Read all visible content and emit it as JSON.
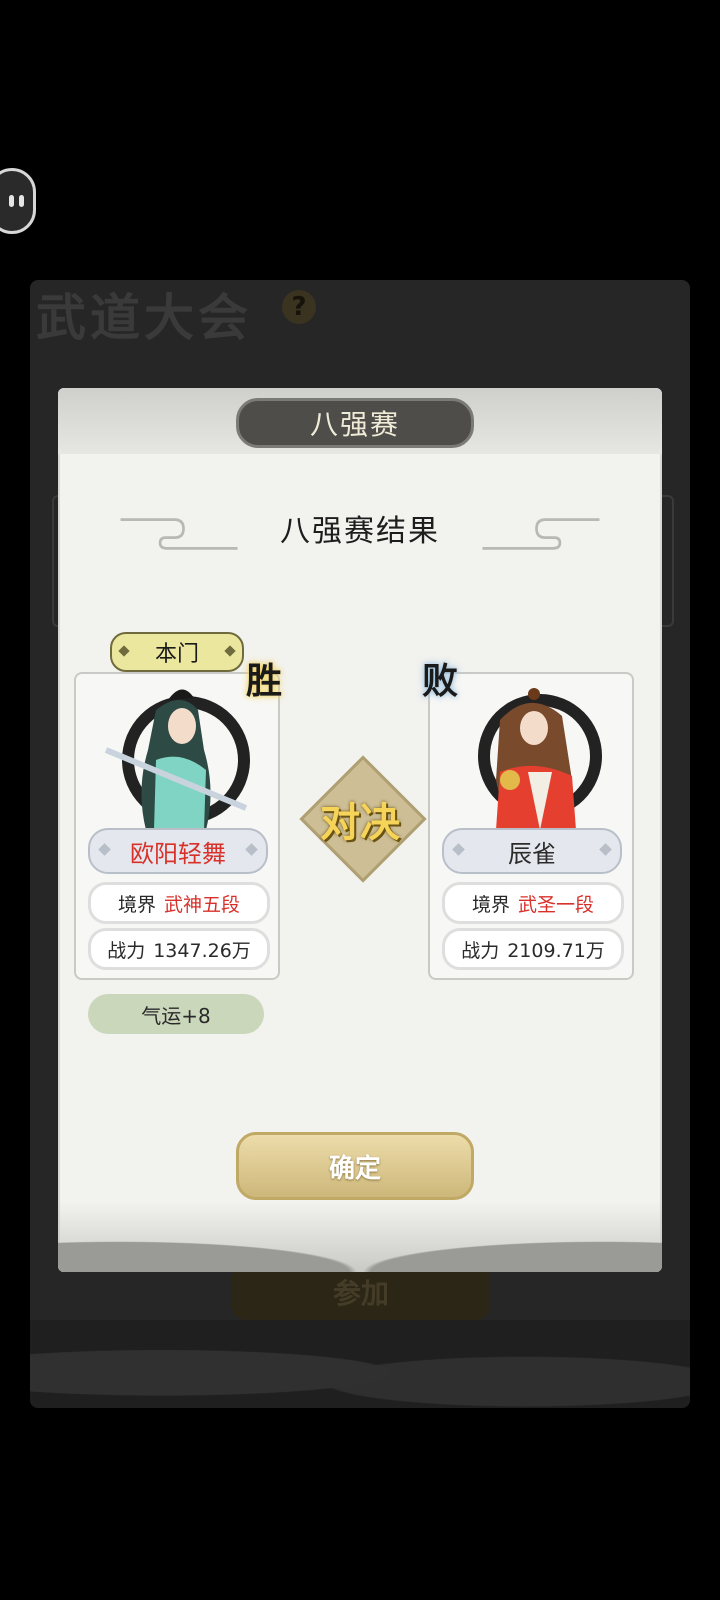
{
  "background": {
    "event_title": "武道大会",
    "help_icon": "?",
    "join_button": "参加"
  },
  "modal": {
    "tab_title": "八强赛",
    "result_title": "八强赛结果",
    "sect_tag": "本门",
    "vs_text": "对决",
    "confirm_button": "确定",
    "player_left": {
      "result": "胜",
      "name": "欧阳轻舞",
      "realm_label": "境界",
      "realm_value": "武神五段",
      "power_label": "战力",
      "power_value": "1347.26万"
    },
    "player_right": {
      "result": "败",
      "name": "辰雀",
      "realm_label": "境界",
      "realm_value": "武圣一段",
      "power_label": "战力",
      "power_value": "2109.71万"
    },
    "luck_text": "气运+8"
  },
  "colors": {
    "win_name": "#d8312a",
    "realm_red": "#d8312a",
    "confirm_gold": "#cdb77a",
    "luck_green": "#cbd7bb"
  }
}
